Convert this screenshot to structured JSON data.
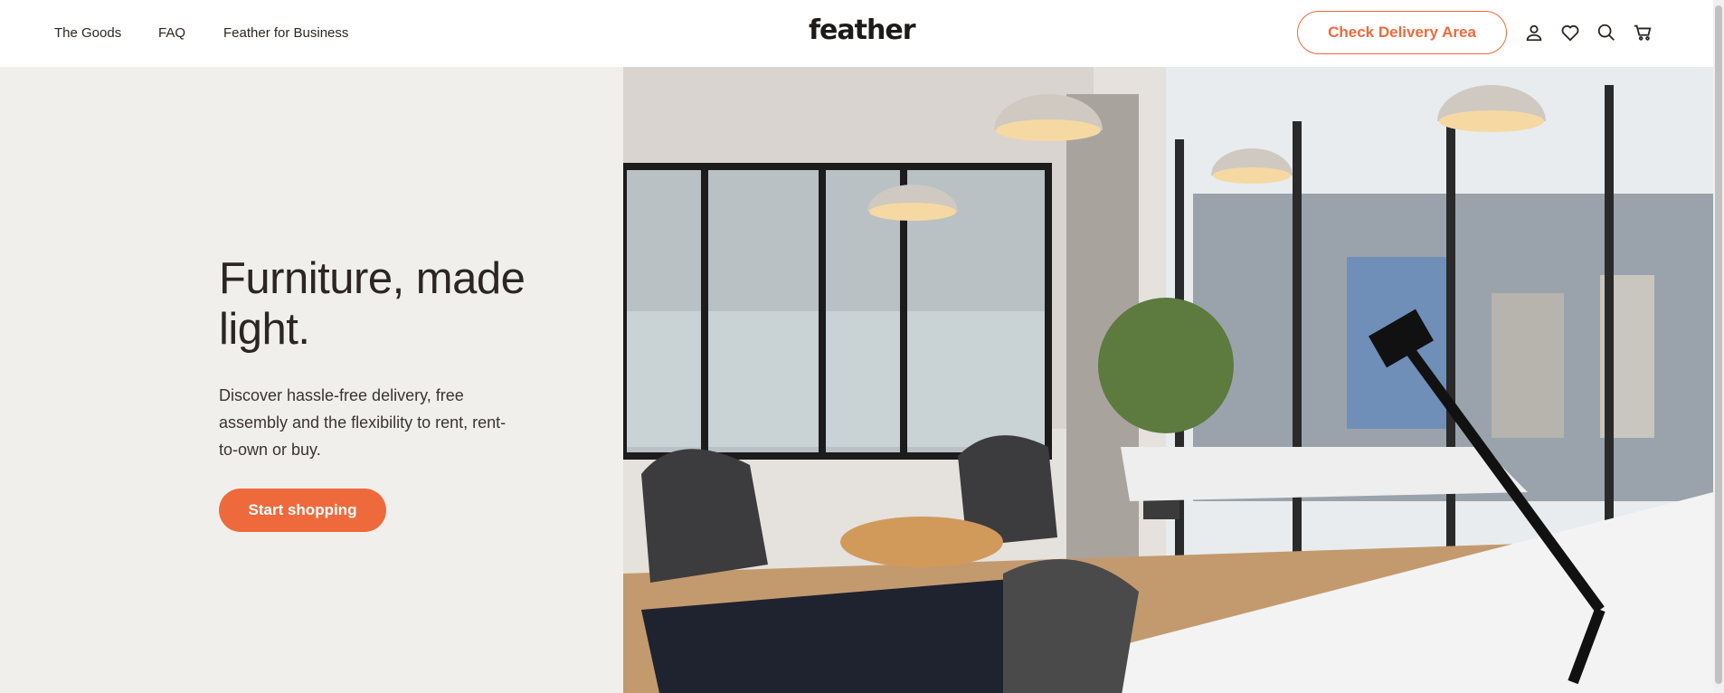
{
  "nav": {
    "links": [
      "The Goods",
      "FAQ",
      "Feather for Business"
    ],
    "logo": "feather",
    "cta": "Check Delivery Area",
    "icons": [
      "account-icon",
      "heart-icon",
      "search-icon",
      "cart-icon"
    ]
  },
  "hero": {
    "title": "Furniture, made light.",
    "subtitle": "Discover hassle-free delivery, free assembly and the flexibility to rent, rent-to-own or buy.",
    "button": "Start shopping"
  },
  "colors": {
    "accent": "#ee6a3d",
    "hero_bg": "#f1efec",
    "text": "#2b2623"
  }
}
